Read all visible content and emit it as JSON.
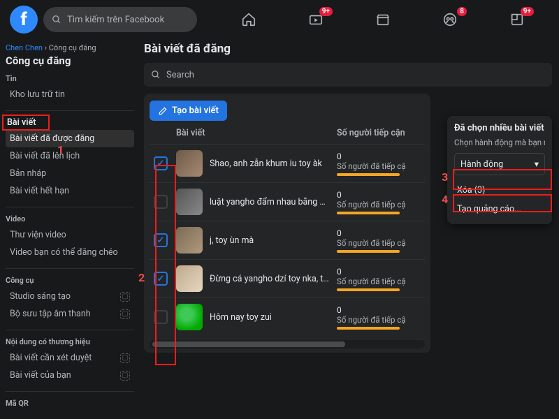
{
  "header": {
    "search_placeholder": "Tìm kiếm trên Facebook",
    "badges": {
      "watch": "9+",
      "groups": "8",
      "gaming": "9+"
    }
  },
  "sidebar": {
    "breadcrumb_user": "Chen Chen",
    "breadcrumb_page": "Công cụ đăng",
    "title": "Công cụ đăng",
    "sections": {
      "tin_label": "Tin",
      "tin_items": [
        "Kho lưu trữ tin"
      ],
      "baiviet_label": "Bài viết",
      "baiviet_items": [
        "Bài viết đã được đăng",
        "Bài viết đã lên lịch",
        "Bản nháp",
        "Bài viết hết hạn"
      ],
      "video_label": "Video",
      "video_items": [
        "Thư viện video",
        "Video bạn có thể đăng chéo"
      ],
      "congcu_label": "Công cụ",
      "congcu_items": [
        "Studio sáng tạo",
        "Bộ sưu tập âm thanh"
      ],
      "brand_label": "Nội dung có thương hiệu",
      "brand_items": [
        "Bài viết cần xét duyệt",
        "Bài viết của bạn"
      ],
      "qr_label": "Mã QR"
    }
  },
  "page": {
    "heading": "Bài viết đã đăng",
    "search_placeholder": "Search",
    "create_button": "Tạo bài viết",
    "col_post": "Bài viết",
    "col_reach": "Số người tiếp cận",
    "reach_sub": "Số người đã tiếp cậ"
  },
  "rows": [
    {
      "checked": true,
      "title": "Shao, anh zẫn khum iu toy àk"
    },
    {
      "checked": false,
      "title": "luật yangho đẩm nhau bằng mã tấu iem iu anh đã..."
    },
    {
      "checked": true,
      "title": "j, toy ùn mà"
    },
    {
      "checked": true,
      "title": "Đừng cá yangho dzí toy nka, toy pắn ák"
    },
    {
      "checked": false,
      "title": "Hôm nay toy zui"
    }
  ],
  "panel": {
    "title": "Đã chọn nhiều bài viết",
    "subtitle": "Chọn hành động mà bạn muốn thự",
    "action_label": "Hành động",
    "delete_label": "Xóa (3)",
    "ads_label": "Tạo quảng cáo..."
  },
  "annotations": {
    "n1": "1",
    "n2": "2",
    "n3": "3",
    "n4": "4"
  }
}
